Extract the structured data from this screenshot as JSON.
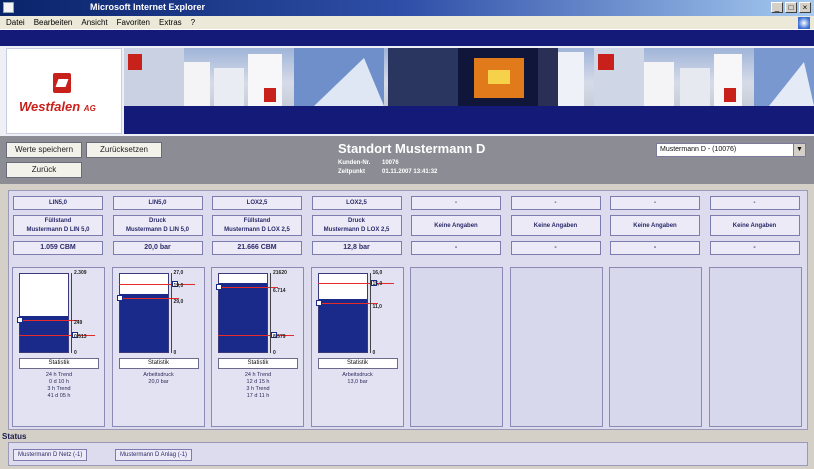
{
  "window": {
    "title": "Microsoft Internet Explorer"
  },
  "menu": {
    "items": [
      "Datei",
      "Bearbeiten",
      "Ansicht",
      "Favoriten",
      "Extras",
      "?"
    ]
  },
  "brand": {
    "name": "Westfalen",
    "suffix": "AG"
  },
  "toolbar": {
    "save_label": "Werte speichern",
    "reset_label": "Zurücksetzen",
    "back_label": "Zurück"
  },
  "station": {
    "title": "Standort Mustermann D",
    "meta": [
      {
        "key": "Kunden-Nr.",
        "value": "10076"
      },
      {
        "key": "Zeitpunkt",
        "value": "01.11.2007 13:41:32"
      }
    ],
    "selector_value": "Mustermann D - (10076)"
  },
  "colors": {
    "fill": "#1a2a8a",
    "alarm": "#e62b2b",
    "panel": "#dcdcee"
  },
  "gauges": [
    {
      "code": "LIN5,0",
      "type": "Füllstand",
      "name": "Mustermann D LIN 5,0",
      "reading": "1.059 CBM",
      "scale_top": "2.309",
      "scale_mid": "0.513",
      "scale_low": "249",
      "scale_bottom": "0",
      "fill_fraction": 0.46,
      "line_fraction": 0.22,
      "stat_label": "Statistik",
      "info": "24 h Trend\n0 d 10 h\n3 h Trend\n41 d 05 h"
    },
    {
      "code": "LIN5,0",
      "type": "Druck",
      "name": "Mustermann D LIN 5,0",
      "reading": "20,0 bar",
      "scale_top": "27,0",
      "scale_mid": "19,0",
      "scale_low": "29,0",
      "scale_bottom": "0",
      "fill_fraction": 0.74,
      "line_fraction": 0.86,
      "stat_label": "Statistik",
      "info": "Arbeitsdruck\n20,0 bar"
    },
    {
      "code": "LOX2,5",
      "type": "Füllstand",
      "name": "Mustermann D LOX 2,5",
      "reading": "21.666 CBM",
      "scale_top": "21620",
      "scale_mid": "8.579",
      "scale_low": "6.714",
      "scale_bottom": "0",
      "fill_fraction": 0.88,
      "line_fraction": 0.22,
      "stat_label": "Statistik",
      "info": "24 h Trend\n12 d 15 h\n3 h Trend\n17 d 11 h"
    },
    {
      "code": "LOX2,5",
      "type": "Druck",
      "name": "Mustermann D LOX 2,5",
      "reading": "12,8 bar",
      "scale_top": "16,0",
      "scale_mid": "15,0",
      "scale_low": "11,0",
      "scale_bottom": "0",
      "fill_fraction": 0.68,
      "line_fraction": 0.88,
      "stat_label": "Statistik",
      "info": "Arbeitsdruck\n13,0 bar"
    }
  ],
  "empty_columns": [
    {
      "code": "-",
      "name": "Keine Angaben",
      "reading": "-"
    },
    {
      "code": "-",
      "name": "Keine Angaben",
      "reading": "-"
    },
    {
      "code": "-",
      "name": "Keine Angaben",
      "reading": "-"
    },
    {
      "code": "-",
      "name": "Keine Angaben",
      "reading": "-"
    }
  ],
  "status": {
    "title": "Status",
    "items": [
      "Mustermann D Netz (-1)",
      "Mustermann D Anlag (-1)"
    ]
  }
}
